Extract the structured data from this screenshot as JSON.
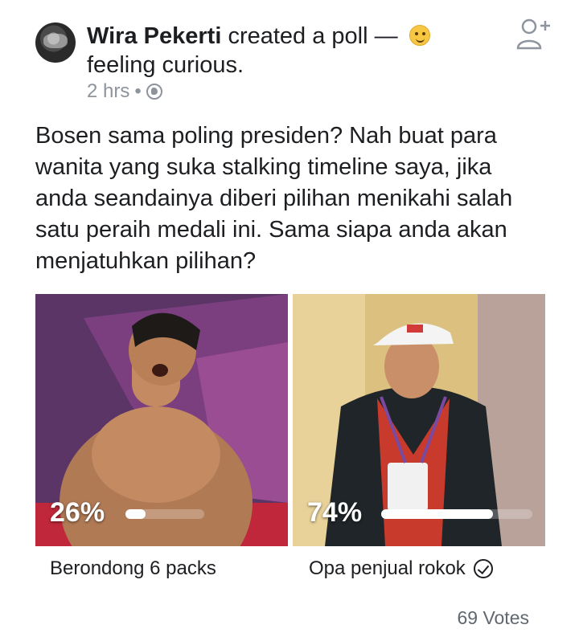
{
  "post": {
    "author": "Wira Pekerti",
    "action": "created a poll —",
    "feeling_text": "feeling curious.",
    "timestamp": "2 hrs",
    "separator": "•",
    "privacy_icon": "globe-icon",
    "body": "Bosen sama poling presiden? Nah buat para\nwanita yang suka stalking timeline saya, jika\nanda seandainya diberi pilihan menikahi salah\nsatu peraih medali ini. Sama siapa anda akan\nmenjatuhkan pilihan?"
  },
  "header": {
    "add_friend_icon": "add-friend-icon"
  },
  "poll": {
    "options": [
      {
        "label": "Berondong 6 packs",
        "percent_text": "26%",
        "percent": 26,
        "selected": false
      },
      {
        "label": "Opa penjual rokok",
        "percent_text": "74%",
        "percent": 74,
        "selected": true
      }
    ],
    "votes_text": "69 Votes"
  },
  "colors": {
    "text": "#1c1e21",
    "meta": "#8d949e",
    "bar": "#ffffff"
  }
}
